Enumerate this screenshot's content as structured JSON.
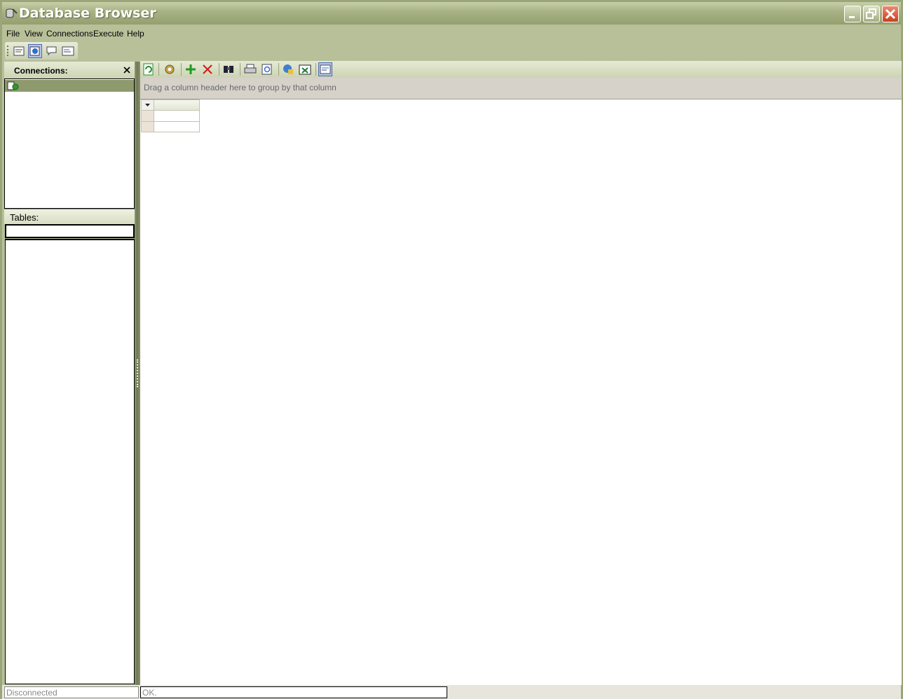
{
  "window": {
    "title": "Database Browser"
  },
  "menu": {
    "items": [
      "File",
      "View",
      "Connections",
      "Execute",
      "Help"
    ]
  },
  "toolbar": {
    "buttons": [
      "sql-editor-icon",
      "browse-icon",
      "chat-icon",
      "properties-icon"
    ],
    "active": "browse-icon"
  },
  "connections": {
    "title": "Connections:"
  },
  "tables": {
    "title": "Tables:",
    "filter_value": ""
  },
  "grid": {
    "group_panel_text": "Drag a column header here to group by that column"
  },
  "status": {
    "connection": "Disconnected",
    "message": "OK."
  },
  "colors": {
    "frame": "#b8c09a",
    "selected_row": "#8e9a6e",
    "close_button": "#d84a28"
  }
}
